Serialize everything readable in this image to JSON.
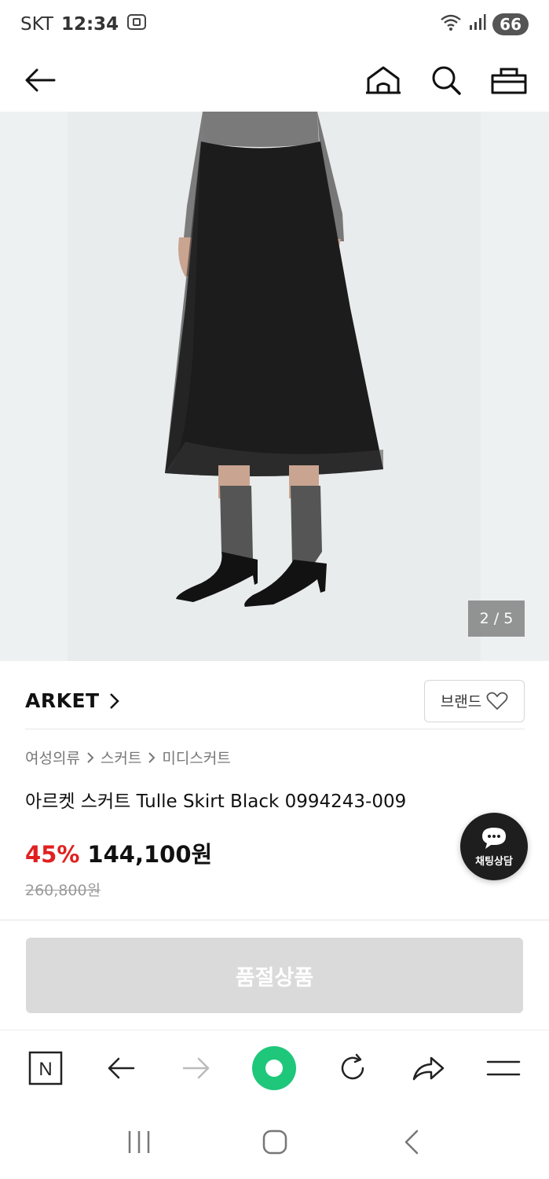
{
  "status_bar": {
    "carrier": "SKT",
    "time": "12:34",
    "battery": "66"
  },
  "product": {
    "image_counter": "2 / 5",
    "brand": "ARKET",
    "brand_like_label": "브랜드",
    "breadcrumb": [
      "여성의류",
      "스커트",
      "미디스커트"
    ],
    "title": "아르켓 스커트 Tulle Skirt Black 0994243-009",
    "discount": "45%",
    "price": "144,100원",
    "original_price": "260,800원"
  },
  "chat": {
    "label": "채팅상담"
  },
  "buy": {
    "soldout_label": "품절상품"
  },
  "browser": {
    "n_label": "N"
  },
  "colors": {
    "discount": "#e02020",
    "naver_green": "#1ec77a",
    "soldout_bg": "#dadada"
  }
}
